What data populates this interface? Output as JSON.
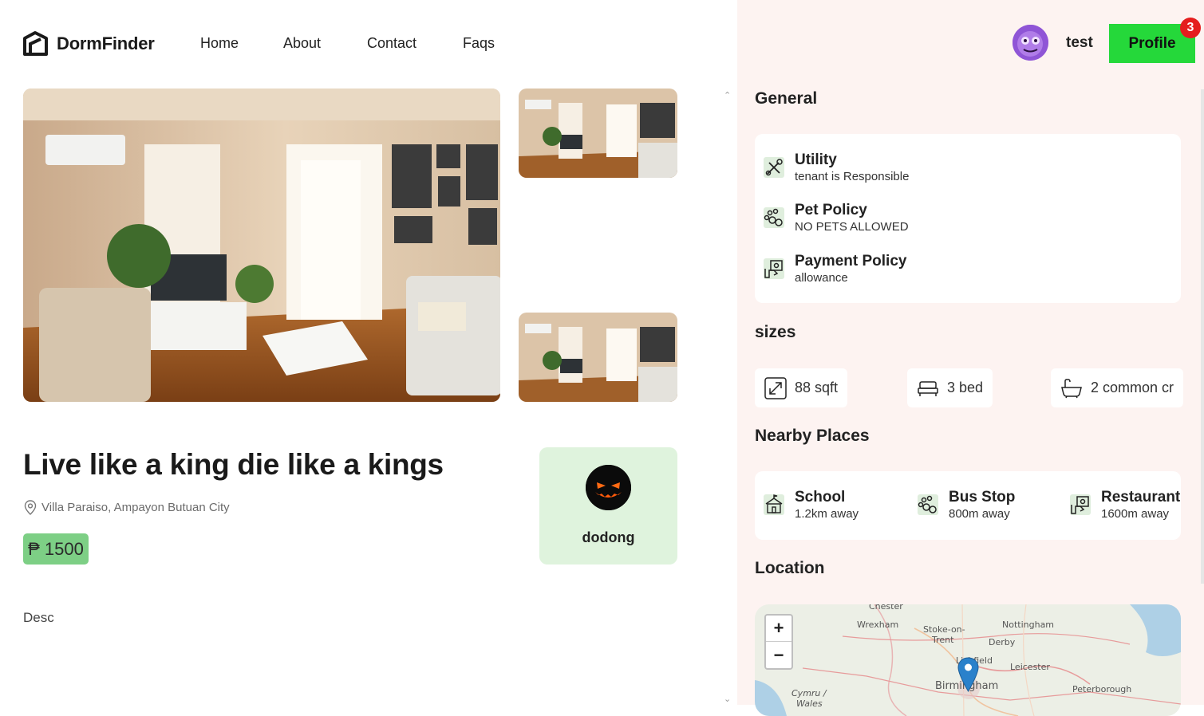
{
  "nav": {
    "brand": "DormFinder",
    "links": [
      "Home",
      "About",
      "Contact",
      "Faqs"
    ]
  },
  "listing": {
    "title": "Live like a king die like a kings",
    "address": "Villa Paraiso, Ampayon Butuan City",
    "price": "₱ 1500",
    "description": "Desc",
    "owner": "dodong"
  },
  "user": {
    "name": "test",
    "profile_label": "Profile",
    "notification_count": "3"
  },
  "general": {
    "heading": "General",
    "items": [
      {
        "title": "Utility",
        "value": "tenant is Responsible",
        "icon": "tools-icon"
      },
      {
        "title": "Pet Policy",
        "value": "NO PETS ALLOWED",
        "icon": "paw-icon"
      },
      {
        "title": "Payment Policy",
        "value": "allowance",
        "icon": "money-hand-icon"
      }
    ]
  },
  "sizes": {
    "heading": "sizes",
    "items": [
      {
        "label": "88 sqft",
        "icon": "expand-icon"
      },
      {
        "label": "3 bed",
        "icon": "bed-icon"
      },
      {
        "label": "2 common cr",
        "icon": "bathtub-icon"
      }
    ]
  },
  "nearby": {
    "heading": "Nearby Places",
    "items": [
      {
        "title": "School",
        "distance": "1.2km away",
        "icon": "school-icon"
      },
      {
        "title": "Bus Stop",
        "distance": "800m away",
        "icon": "paw-icon"
      },
      {
        "title": "Restaurant",
        "distance": "1600m away",
        "icon": "money-hand-icon"
      }
    ]
  },
  "location": {
    "heading": "Location",
    "zoom_in": "+",
    "zoom_out": "−",
    "labels": [
      "Chester",
      "Wrexham",
      "Stoke-on-",
      "Trent",
      "Nottingham",
      "Derby",
      "Lichfield",
      "Leicester",
      "Birmingham",
      "Peterborough",
      "Cymru /",
      "Wales"
    ]
  },
  "colors": {
    "accent_green": "#25d83a",
    "price_bg": "#7dcf85",
    "owner_bg": "#dff3dd",
    "panel_bg": "#fdf3f1",
    "badge_red": "#e51e1e"
  }
}
